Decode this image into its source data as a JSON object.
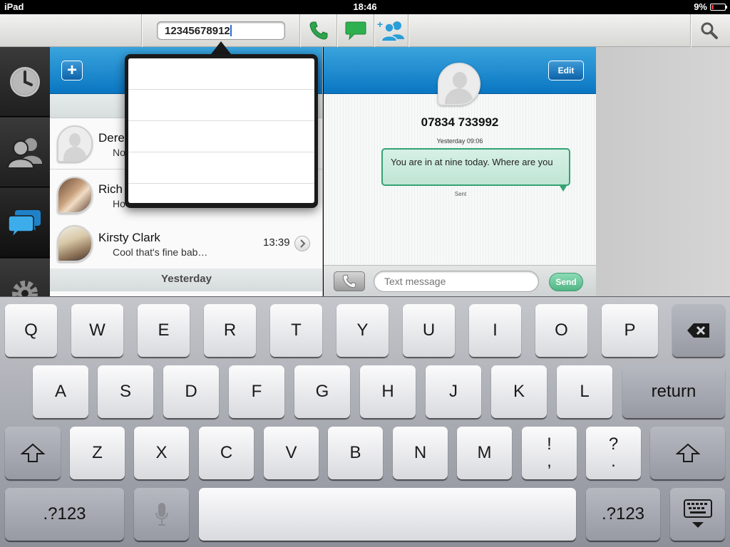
{
  "status_bar": {
    "device": "iPad",
    "time": "18:46",
    "battery": "9%"
  },
  "toolbar": {
    "number_value": "12345678912",
    "call_icon": "phone-icon",
    "message_icon": "chat-bubble-icon",
    "add_contact_icon": "add-contact-icon",
    "search_icon": "search-icon"
  },
  "nav": [
    "clock-icon",
    "contacts-icon",
    "messages-icon",
    "settings-icon"
  ],
  "conversations": [
    {
      "name": "Dere",
      "preview": "No",
      "time": ""
    },
    {
      "name": "Rich",
      "preview": "Ho",
      "time": ""
    },
    {
      "name": "Kirsty Clark",
      "preview": "Cool that's fine bab…",
      "time": "13:39"
    }
  ],
  "date_header": "Yesterday",
  "chat": {
    "edit_label": "Edit",
    "number": "07834 733992",
    "date": "Yesterday 09:06",
    "message": "You are in at nine today. Where are you",
    "status": "Sent",
    "placeholder": "Text message",
    "send_label": "Send"
  },
  "keyboard": {
    "row1": [
      "Q",
      "W",
      "E",
      "R",
      "T",
      "Y",
      "U",
      "I",
      "O",
      "P"
    ],
    "row2": [
      "A",
      "S",
      "D",
      "F",
      "G",
      "H",
      "J",
      "K",
      "L"
    ],
    "row3": [
      "Z",
      "X",
      "C",
      "V",
      "B",
      "N",
      "M"
    ],
    "return_label": "return",
    "punct1": [
      "!",
      ","
    ],
    "punct2": [
      "?",
      "."
    ],
    "numbers_label": ".?123"
  }
}
